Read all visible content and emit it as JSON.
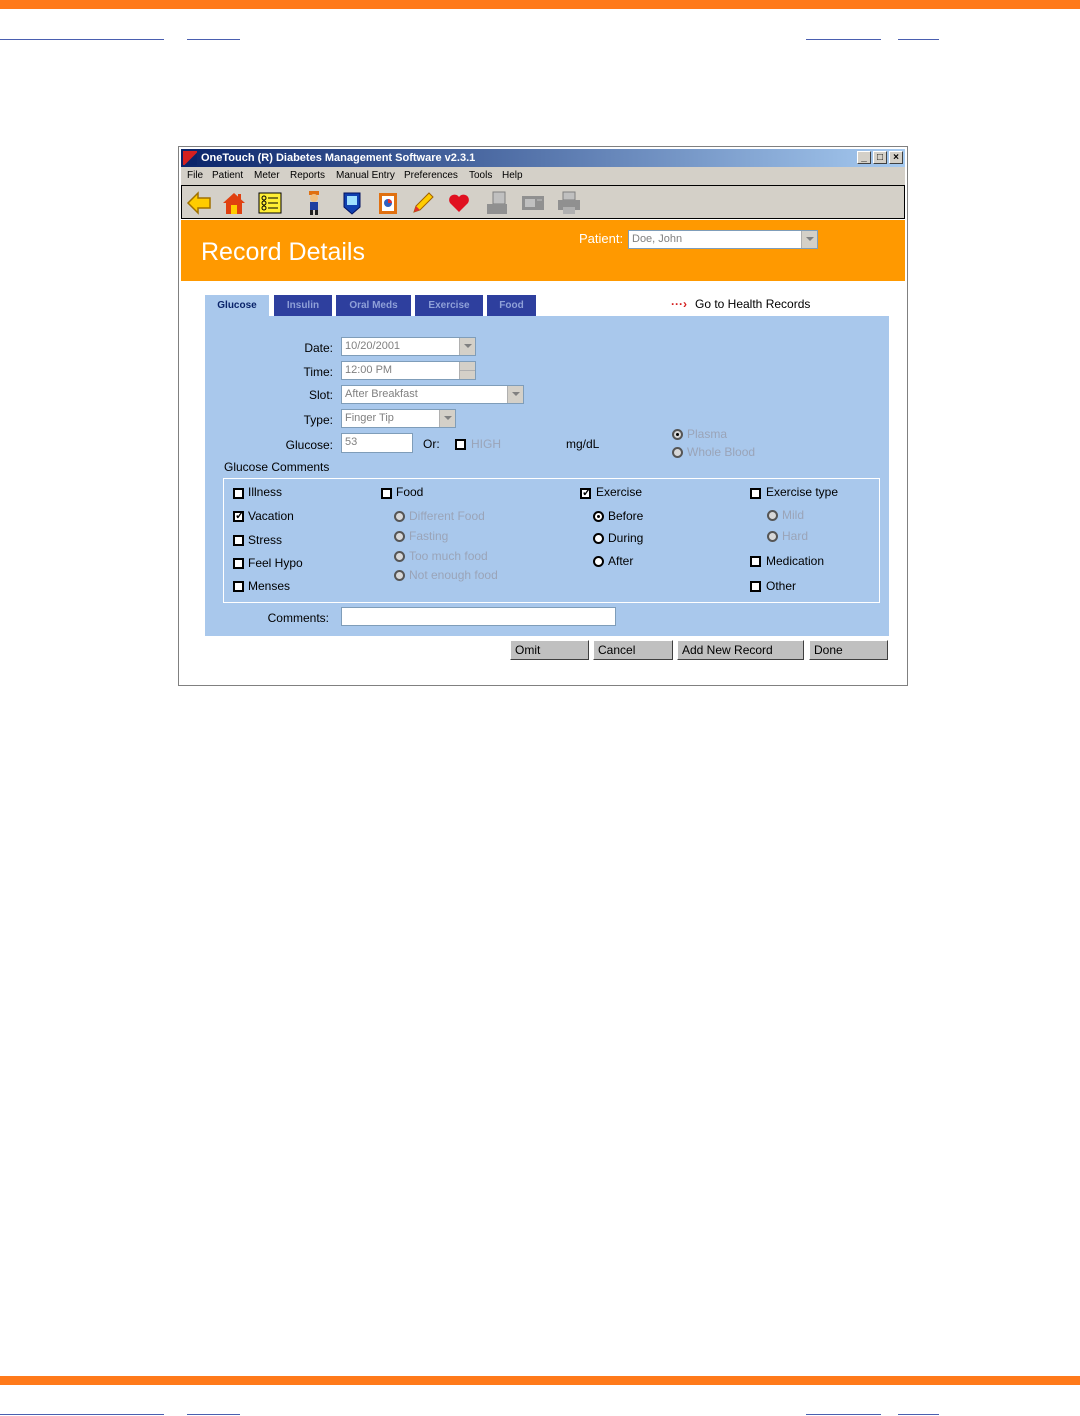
{
  "window": {
    "title": "OneTouch (R) Diabetes Management Software v2.3.1",
    "minimize": "_",
    "maximize": "□",
    "close": "×"
  },
  "menu": [
    "File",
    "Patient",
    "Meter",
    "Reports",
    "Manual Entry",
    "Preferences",
    "Tools",
    "Help"
  ],
  "toolbar_icons": [
    "back-arrow-icon",
    "home-icon",
    "checklist-icon",
    "person-icon",
    "meter-icon",
    "clipboard-icon",
    "pencil-icon",
    "heart-icon",
    "print-icon",
    "meter-download-icon",
    "printer-icon"
  ],
  "header": {
    "title": "Record Details",
    "patient_label": "Patient:",
    "patient_value": "Doe, John"
  },
  "tabs": [
    "Glucose",
    "Insulin",
    "Oral Meds",
    "Exercise",
    "Food"
  ],
  "health_link": "Go to Health Records",
  "form": {
    "date_label": "Date:",
    "date_value": "10/20/2001",
    "time_label": "Time:",
    "time_value": "12:00 PM",
    "slot_label": "Slot:",
    "slot_value": "After Breakfast",
    "type_label": "Type:",
    "type_value": "Finger Tip",
    "glucose_label": "Glucose:",
    "glucose_value": "53",
    "or_label": "Or:",
    "high_label": "HIGH",
    "unit": "mg/dL",
    "plasma": "Plasma",
    "whole_blood": "Whole Blood",
    "comments_section": "Glucose Comments",
    "comments_label": "Comments:",
    "comments_value": ""
  },
  "col1": [
    {
      "label": "Illness",
      "checked": false
    },
    {
      "label": "Vacation",
      "checked": true
    },
    {
      "label": "Stress",
      "checked": false
    },
    {
      "label": "Feel Hypo",
      "checked": false
    },
    {
      "label": "Menses",
      "checked": false
    }
  ],
  "food": {
    "label": "Food",
    "options": [
      "Different Food",
      "Fasting",
      "Too much food",
      "Not enough food"
    ]
  },
  "exercise": {
    "label": "Exercise",
    "options": [
      "Before",
      "During",
      "After"
    ],
    "selected": "Before"
  },
  "exercise_type": {
    "label": "Exercise type",
    "options": [
      "Mild",
      "Hard"
    ]
  },
  "medication": "Medication",
  "other": "Other",
  "buttons": {
    "omit": "Omit",
    "cancel": "Cancel",
    "add_new": "Add New Record",
    "done": "Done"
  },
  "colors": {
    "accent": "#ff9900",
    "panel": "#a9c8ec",
    "tab": "#2e3f9e",
    "page_bar": "#ff7a1a"
  }
}
